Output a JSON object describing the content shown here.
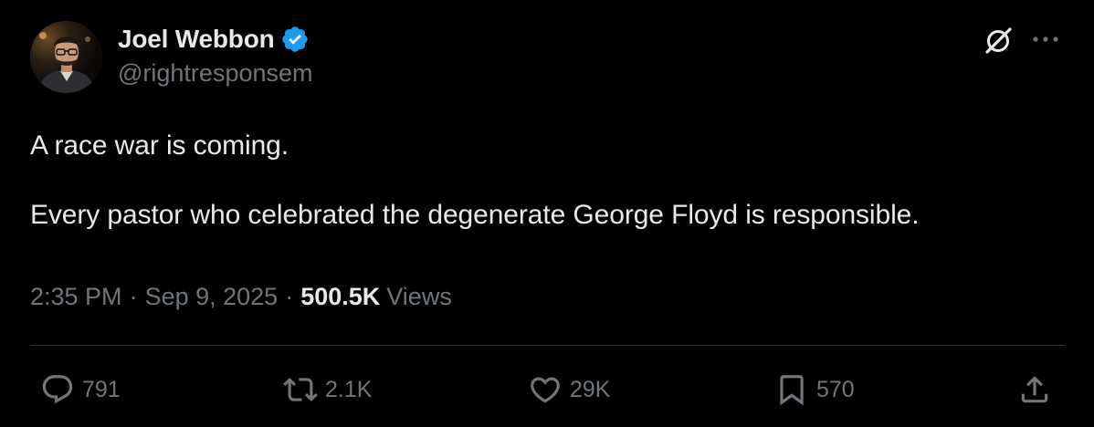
{
  "author": {
    "display_name": "Joel Webbon",
    "handle": "@rightresponsem",
    "verified": true
  },
  "tweet": {
    "text": "A race war is coming.\n\nEvery pastor who celebrated the degenerate George Floyd is responsible.",
    "time": "2:35 PM",
    "separator": "·",
    "date": "Sep 9, 2025",
    "views_count": "500.5K",
    "views_label": "Views"
  },
  "actions": {
    "replies": "791",
    "reposts": "2.1K",
    "likes": "29K",
    "bookmarks": "570"
  },
  "icons": {
    "verified": "verified-badge-icon",
    "grok": "grok-icon",
    "more": "more-dots-icon",
    "reply": "reply-bubble-icon",
    "repost": "repost-arrows-icon",
    "like": "heart-icon",
    "bookmark": "bookmark-icon",
    "share": "share-upload-icon"
  },
  "colors": {
    "background": "#000000",
    "text_primary": "#e7e9ea",
    "text_secondary": "#71767b",
    "verified_blue": "#1d9bf0",
    "divider": "#2f3336"
  }
}
